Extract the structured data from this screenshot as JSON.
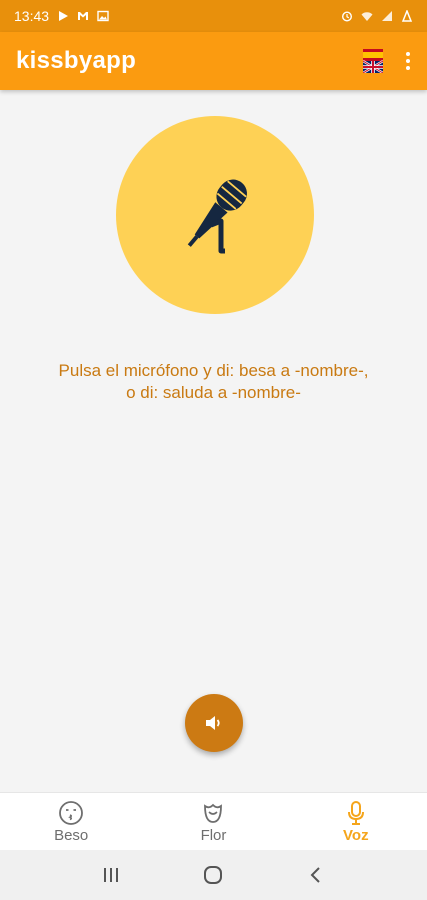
{
  "status_bar": {
    "time": "13:43",
    "left_icons": [
      "play-store-icon",
      "gmail-icon",
      "gallery-icon"
    ],
    "right_icons": [
      "alarm-icon",
      "wifi-icon",
      "signal-icon",
      "battery-icon"
    ]
  },
  "app_bar": {
    "title": "kissbyapp",
    "language_flag_icon": "spain-uk-flag-icon",
    "menu_icon": "more-vert-icon"
  },
  "main": {
    "mic_icon": "microphone-icon",
    "instruction_line1": "Pulsa el micrófono y di: besa a -nombre-,",
    "instruction_line2": "o di: saluda a -nombre-",
    "fab_icon": "speaker-icon"
  },
  "bottom_nav": {
    "items": [
      {
        "label": "Beso",
        "icon": "kiss-face-icon",
        "active": false
      },
      {
        "label": "Flor",
        "icon": "rose-icon",
        "active": false
      },
      {
        "label": "Voz",
        "icon": "microphone-icon",
        "active": true
      }
    ]
  },
  "system_nav": {
    "buttons": [
      "recents-icon",
      "home-icon",
      "back-icon"
    ]
  },
  "colors": {
    "status_bar": "#e8900c",
    "app_bar": "#fb9b10",
    "mic_circle": "#fed155",
    "instruction_text": "#c97a12",
    "fab": "#cc7a13",
    "nav_active": "#f5a51b",
    "nav_inactive": "#6e6e6e"
  }
}
